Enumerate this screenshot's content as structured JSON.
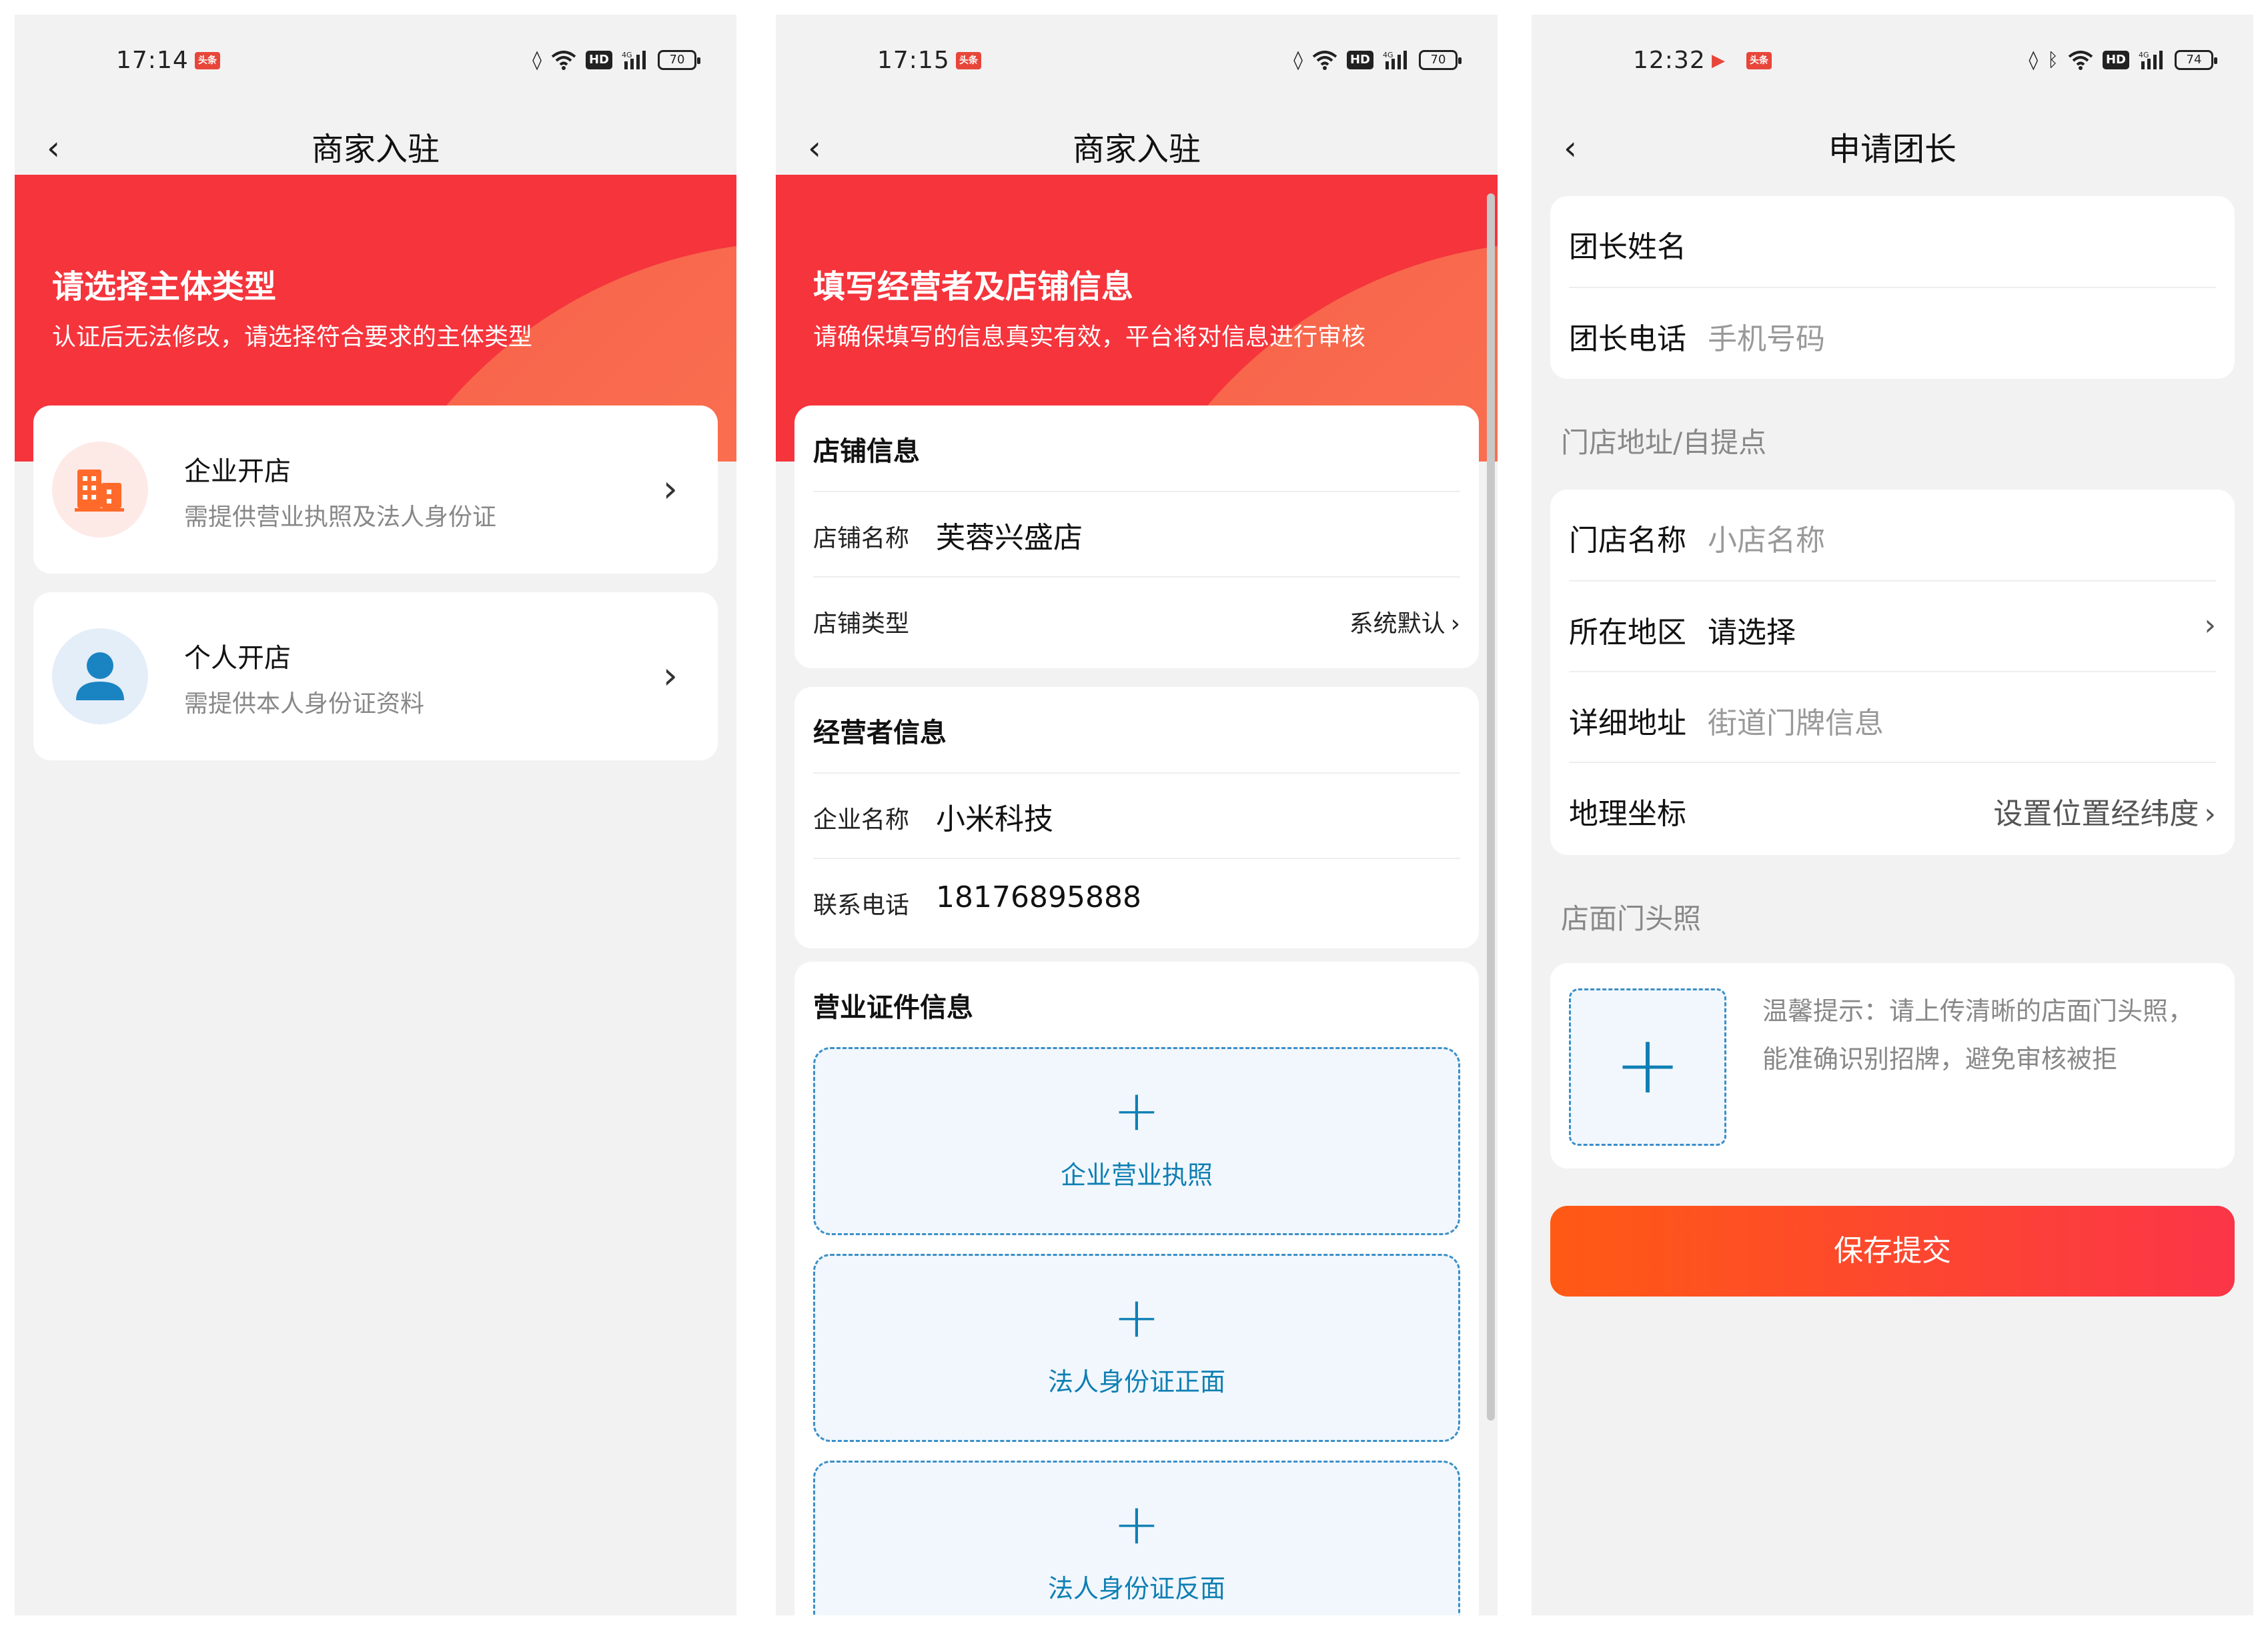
{
  "screens": [
    {
      "status": {
        "time": "17:14",
        "app_badge": "头条",
        "battery": "70"
      },
      "nav": {
        "back_icon": "‹",
        "title": "商家入驻"
      },
      "banner": {
        "title": "请选择主体类型",
        "subtitle": "认证后无法修改，请选择符合要求的主体类型"
      },
      "options": [
        {
          "title": "企业开店",
          "subtitle": "需提供营业执照及法人身份证",
          "icon": "building-icon"
        },
        {
          "title": "个人开店",
          "subtitle": "需提供本人身份证资料",
          "icon": "person-icon"
        }
      ]
    },
    {
      "status": {
        "time": "17:15",
        "app_badge": "头条",
        "battery": "70"
      },
      "nav": {
        "back_icon": "‹",
        "title": "商家入驻"
      },
      "banner": {
        "title": "填写经营者及店铺信息",
        "subtitle": "请确保填写的信息真实有效，平台将对信息进行审核"
      },
      "store_info": {
        "title": "店铺信息",
        "name_label": "店铺名称",
        "name_value": "芙蓉兴盛店",
        "type_label": "店铺类型",
        "type_value": "系统默认"
      },
      "operator_info": {
        "title": "经营者信息",
        "company_label": "企业名称",
        "company_value": "小米科技",
        "phone_label": "联系电话",
        "phone_value": "18176895888"
      },
      "license_info": {
        "title": "营业证件信息",
        "uploads": [
          "企业营业执照",
          "法人身份证正面",
          "法人身份证反面"
        ]
      }
    },
    {
      "status": {
        "time": "12:32",
        "app_badge": "头条",
        "battery": "74"
      },
      "nav": {
        "back_icon": "‹",
        "title": "申请团长"
      },
      "leader": {
        "name_label": "团长姓名",
        "phone_label": "团长电话",
        "phone_placeholder": "手机号码"
      },
      "address_section": "门店地址/自提点",
      "address": {
        "store_label": "门店名称",
        "store_placeholder": "小店名称",
        "region_label": "所在地区",
        "region_value": "请选择",
        "detail_label": "详细地址",
        "detail_placeholder": "街道门牌信息",
        "coord_label": "地理坐标",
        "coord_action": "设置位置经纬度"
      },
      "photo_section": "店面门头照",
      "photo_tip": "温馨提示：请上传清晰的店面门头照，能准确识别招牌，避免审核被拒",
      "submit_label": "保存提交"
    }
  ],
  "colors": {
    "brand_red": "#f5343c",
    "accent_blue": "#0f7fb3",
    "submit_orange": "#ff5a14"
  }
}
